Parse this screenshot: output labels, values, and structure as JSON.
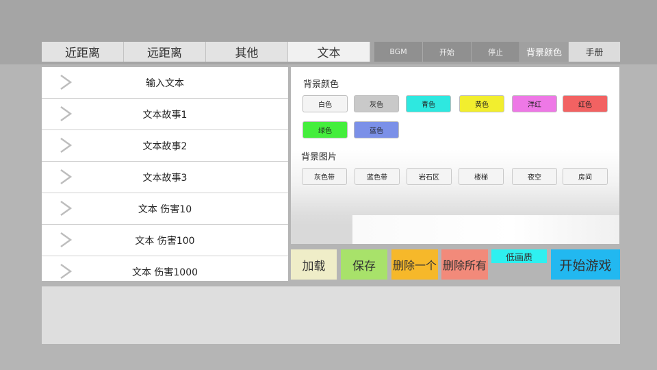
{
  "tabs": [
    {
      "label": "近距离"
    },
    {
      "label": "远距离"
    },
    {
      "label": "其他"
    },
    {
      "label": "文本"
    }
  ],
  "toolbar": {
    "bgm": "BGM",
    "start": "开始",
    "stop": "停止",
    "bg_color": "背景颜色",
    "manual": "手册"
  },
  "list": {
    "items": [
      {
        "label": "输入文本"
      },
      {
        "label": "文本故事1"
      },
      {
        "label": "文本故事2"
      },
      {
        "label": "文本故事3"
      },
      {
        "label": "文本 伤害10"
      },
      {
        "label": "文本 伤害100"
      },
      {
        "label": "文本 伤害1000"
      }
    ]
  },
  "background": {
    "color_title": "背景颜色",
    "colors": [
      {
        "label": "白色",
        "color": "#f4f4f4"
      },
      {
        "label": "灰色",
        "color": "#c9c9c9"
      },
      {
        "label": "青色",
        "color": "#2ee8e0"
      },
      {
        "label": "黄色",
        "color": "#f2ee2e"
      },
      {
        "label": "洋红",
        "color": "#ee78e6"
      },
      {
        "label": "红色",
        "color": "#f26262"
      },
      {
        "label": "绿色",
        "color": "#44ee3c"
      },
      {
        "label": "蓝色",
        "color": "#7b90e8"
      }
    ],
    "image_title": "背景图片",
    "images": [
      {
        "label": "灰色带"
      },
      {
        "label": "蓝色带"
      },
      {
        "label": "岩石区"
      },
      {
        "label": "楼梯"
      },
      {
        "label": "夜空"
      },
      {
        "label": "房间"
      }
    ]
  },
  "actions": {
    "load": "加载",
    "save": "保存",
    "delete_one": "删除一个",
    "delete_all": "删除所有",
    "low_quality": "低画质",
    "start_game": "开始游戏",
    "colors": {
      "load": "#efedc8",
      "save": "#a8e26a",
      "delete_one": "#f6b82a",
      "delete_all": "#f28a7a",
      "low_quality": "#2ef0f0",
      "start_game": "#22b8f0"
    }
  }
}
